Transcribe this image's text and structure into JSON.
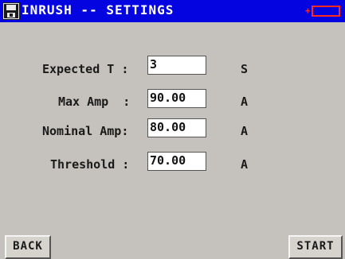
{
  "header": {
    "title": "INRUSH -- SETTINGS",
    "app_icon": "floppy-disk-icon",
    "battery_icon": "battery-icon",
    "battery_symbol": "+"
  },
  "form": {
    "fields": [
      {
        "label": "Expected T :",
        "value": "3",
        "unit": "S"
      },
      {
        "label": "Max Amp  :",
        "value": "90.00",
        "unit": "A"
      },
      {
        "label": "Nominal Amp:",
        "value": "80.00",
        "unit": "A"
      },
      {
        "label": "Threshold :",
        "value": "70.00",
        "unit": "A"
      }
    ]
  },
  "buttons": {
    "back": "BACK",
    "start": "START"
  },
  "colors": {
    "titlebar": "#0404e0",
    "background": "#c5c1bc",
    "battery": "#ff2a1e"
  }
}
